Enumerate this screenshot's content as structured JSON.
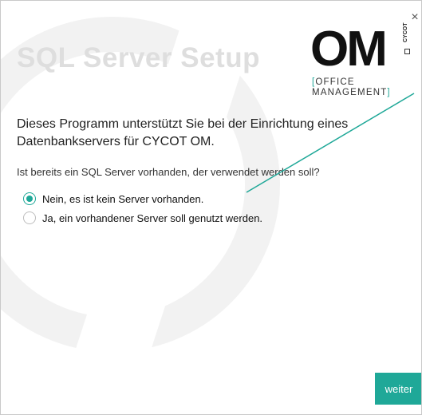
{
  "window": {
    "close_label": "×"
  },
  "title": "SQL Server Setup",
  "logo": {
    "om": "OM",
    "cycot": "CYCOT",
    "line1_bracket": "[",
    "line1_text": "OFFICE",
    "line2_text": "MANAGEMENT",
    "line2_bracket": "]"
  },
  "intro": {
    "line1": "Dieses Programm unterstützt Sie bei der Einrichtung eines",
    "line2": "Datenbankservers für CYCOT OM."
  },
  "question": "Ist bereits ein SQL Server vorhanden, der verwendet werden soll?",
  "options": [
    {
      "label": "Nein, es ist kein Server vorhanden.",
      "checked": true
    },
    {
      "label": "Ja, ein vorhandener Server soll genutzt werden.",
      "checked": false
    }
  ],
  "next_label": "weiter",
  "colors": {
    "accent": "#1fa898",
    "title": "#dedede"
  }
}
